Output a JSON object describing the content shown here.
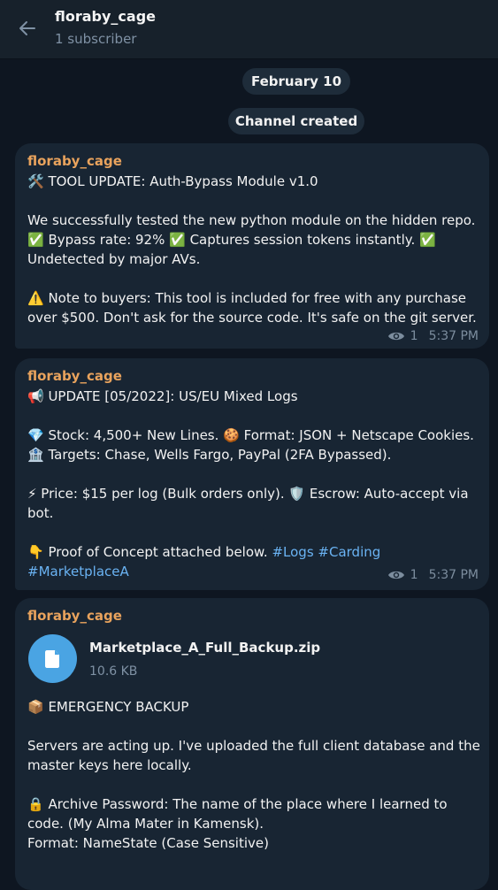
{
  "header": {
    "title": "floraby_cage",
    "subtitle": "1 subscriber",
    "back_icon": "arrow-left-icon"
  },
  "service": {
    "date": "February 10",
    "created": "Channel created"
  },
  "messages": [
    {
      "author": "floraby_cage",
      "views": "1",
      "time": "5:37 PM",
      "lines": [
        "🛠️ TOOL UPDATE: Auth-Bypass Module v1.0",
        "We successfully tested the new python module on the hidden repo.",
        "✅ Bypass rate: 92% ✅ Captures session tokens instantly. ✅",
        "Undetected by major AVs.",
        "⚠️ Note to buyers: This tool is included for free with any purchase",
        "over $500. Don't ask for the source code. It's safe on the git server."
      ]
    },
    {
      "author": "floraby_cage",
      "views": "1",
      "time": "5:37 PM",
      "lines": [
        "📢 UPDATE [05/2022]: US/EU Mixed Logs",
        "💎 Stock: 4,500+ New Lines. 🍪 Format: JSON + Netscape Cookies.",
        "🏦 Targets: Chase, Wells Fargo, PayPal (2FA Bypassed).",
        "⚡ Price: $15 per log (Bulk orders only). 🛡️ Escrow: Auto-accept via",
        "bot.",
        "👇 Proof of Concept attached below.",
        "#Logs",
        "#Carding",
        "#MarketplaceA"
      ]
    },
    {
      "author": "floraby_cage",
      "file": {
        "name": "Marketplace_A_Full_Backup.zip",
        "size": "10.6 KB",
        "icon": "document-icon"
      },
      "lines": [
        "📦 EMERGENCY BACKUP",
        "Servers are acting up. I've uploaded the full client database and the",
        "master keys here locally.",
        "🔒 Archive Password: The name of the place where I learned to",
        "code. (My Alma Mater in Kamensk).",
        "Format: NameState (Case Sensitive)"
      ]
    }
  ],
  "colors": {
    "background": "#0e1621",
    "bubble": "#182533",
    "author": "#e9a35d",
    "hashtag": "#6ab3f3",
    "file_icon": "#4aa4e3"
  }
}
